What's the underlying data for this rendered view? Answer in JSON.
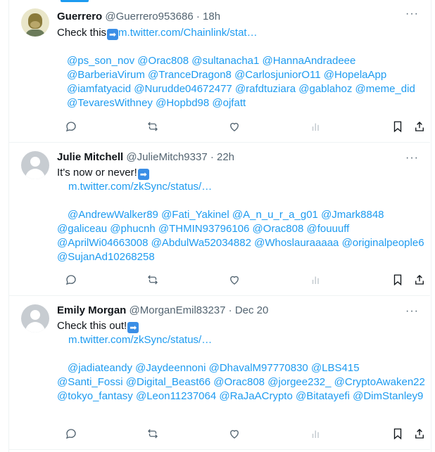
{
  "tweets": [
    {
      "name": "Guerrero",
      "handle": "@Guerrero953686 · 18h",
      "text_main": "Check this",
      "text_link": "m.twitter.com/Chainlink/stat…",
      "mentions": [
        "@ps_son_nov",
        "@Orac808",
        "@sultanacha1",
        "@HannaAndradeee",
        "@BarberiaVirum",
        "@TranceDragon8",
        "@CarlosjuniorO11",
        "@HopelaApp",
        "@iamfatyacid",
        "@Nurudde04672477",
        "@rafdtuziara",
        "@gablahoz",
        "@meme_did",
        "@TevaresWithney",
        "@Hopbd98",
        "@ojfatt"
      ],
      "avatar": "ape-avatar"
    },
    {
      "name": "Julie Mitchell",
      "handle": "@JulieMitch9337 · 22h",
      "text_main": "It's now or never!",
      "text_link": "m.twitter.com/zkSync/status/…",
      "mentions": [
        "@AndrewWalker89",
        "@Fati_Yakinel",
        "@A_n_u_r_a_g01",
        "@Jmark8848",
        "@galiceau",
        "@phucnh",
        "@THMIN93796106",
        "@Orac808",
        "@fouuuff",
        "@AprilWi04663008",
        "@AbdulWa52034882",
        "@Whoslauraaaaa",
        "@originalpeople6",
        "@SujanAd10268258"
      ],
      "avatar": "default-avatar"
    },
    {
      "name": "Emily Morgan",
      "handle": "@MorganEmil83237 · Dec 20",
      "text_main": "Check this out!",
      "text_link": "m.twitter.com/zkSync/status/…",
      "mentions": [
        "@jadiateandy",
        "@Jaydeennoni",
        "@DhavalM97770830",
        "@LBS415",
        "@Santi_Fossi",
        "@Digital_Beast66",
        "@Orac808",
        "@jorgee232_",
        "@CryptoAwaken22",
        "@tokyo_fantasy",
        "@Leon11237064",
        "@RaJaACrypto",
        "@Bitatayefi",
        "@DimStanley9"
      ],
      "avatar": "default-avatar"
    }
  ],
  "ui": {
    "more_glyph": "···",
    "arrow_glyph": "➡",
    "icons": [
      "reply-icon",
      "retweet-icon",
      "like-icon",
      "views-icon",
      "bookmark-icon",
      "share-icon"
    ],
    "accent_color": "#1d9bf0",
    "text_color": "#0f1419",
    "muted_color": "#536471"
  }
}
